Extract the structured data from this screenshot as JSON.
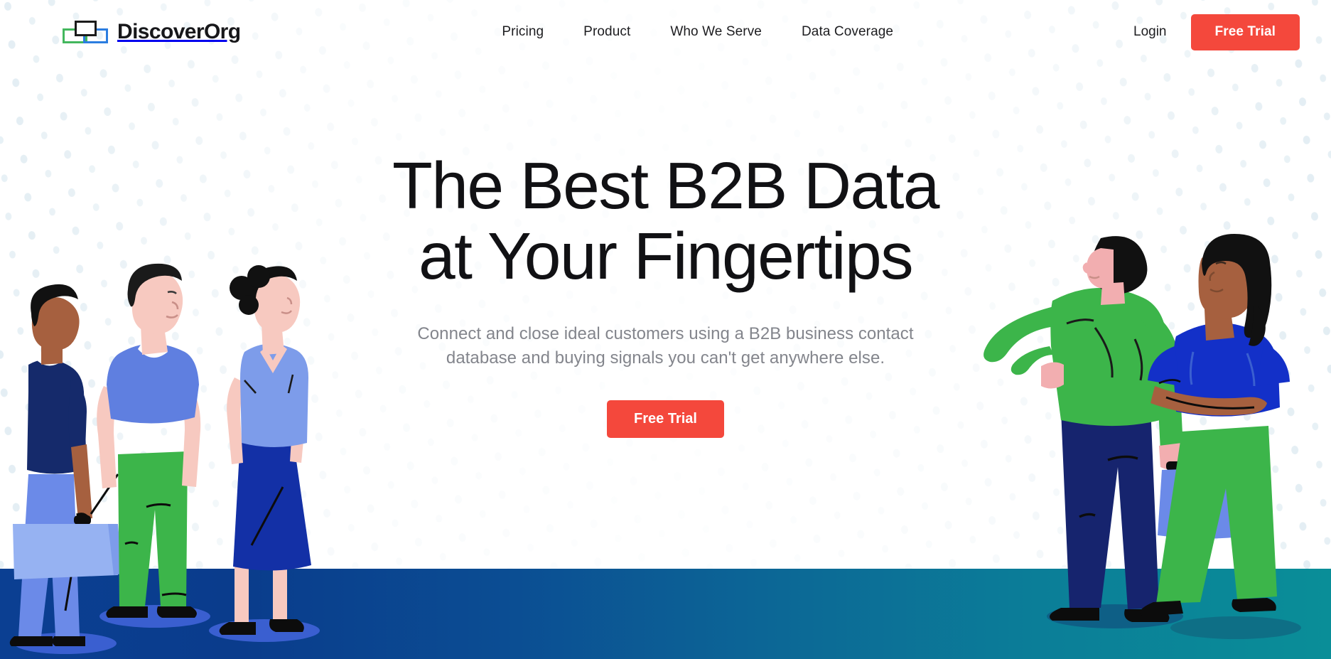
{
  "brand": {
    "name": "DiscoverOrg",
    "logo_colors": {
      "green": "#43b75d",
      "blue": "#2b7de0",
      "black": "#1b1b1b"
    }
  },
  "header": {
    "nav": [
      {
        "label": "Pricing"
      },
      {
        "label": "Product"
      },
      {
        "label": "Who We Serve"
      },
      {
        "label": "Data Coverage"
      }
    ],
    "login_label": "Login",
    "cta_label": "Free Trial"
  },
  "hero": {
    "title": "The Best B2B Data\nat Your Fingertips",
    "subtitle": "Connect and close ideal customers using a B2B business contact\ndatabase and buying signals you can't get anywhere else.",
    "cta_label": "Free Trial"
  },
  "colors": {
    "accent_red": "#f4483c",
    "heading": "#111114",
    "body_text": "#83858c",
    "ground_left": "#0a3c8c",
    "ground_right": "#0a8e98",
    "dot": "#dfeaf2"
  },
  "illustration": {
    "left_figures": [
      {
        "name": "man-navy-shirt-briefcase",
        "top": "#152a6b",
        "bottom": "#6b8ae8",
        "skin": "#a6603f",
        "hair": "#111111"
      },
      {
        "name": "man-blue-polo-green-pants",
        "top": "#5f7fe0",
        "bottom": "#3cb54a",
        "skin": "#f7c9c0",
        "hair": "#1a1a1a"
      },
      {
        "name": "woman-blue-top-navy-skirt",
        "top": "#7d9cea",
        "bottom": "#1330a6",
        "skin": "#f7c9c0",
        "hair": "#111111"
      }
    ],
    "right_figures": [
      {
        "name": "man-green-sweater-briefcase",
        "top": "#3cb54a",
        "bottom": "#16246e",
        "skin": "#f2aeb0",
        "hair": "#111111"
      },
      {
        "name": "woman-blue-top-green-pants",
        "top": "#1330c8",
        "bottom": "#3cb54a",
        "skin": "#a6603f",
        "hair": "#111111"
      }
    ],
    "briefcase_color": "#7d9cea",
    "shadow_color": "#3a5fd0"
  }
}
